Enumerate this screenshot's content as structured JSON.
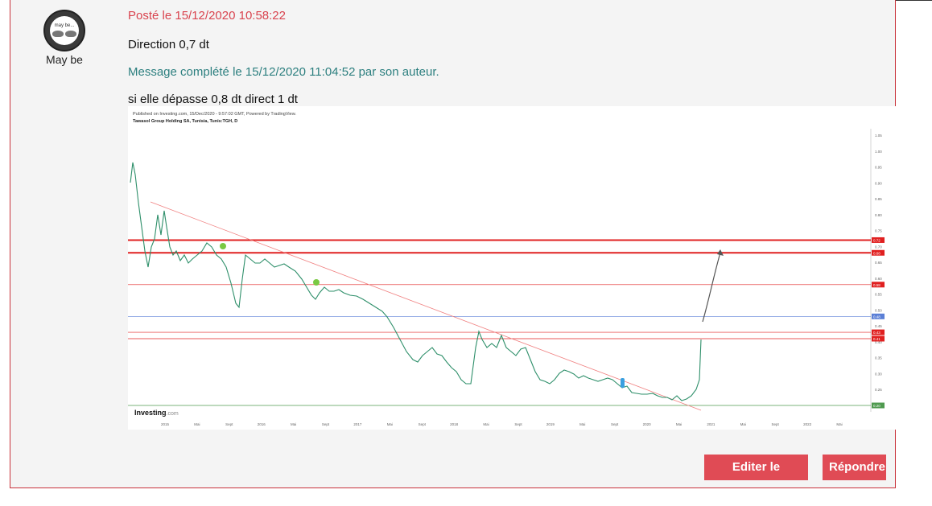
{
  "post": {
    "username": "May be",
    "avatar_text": "may be...",
    "posted_label": "Posté le 15/12/2020 10:58:22",
    "message_line1": "Direction 0,7 dt",
    "edited_note": "Message complété le 15/12/2020 11:04:52 par son auteur.",
    "message_line2": "si elle dépasse 0,8 dt direct 1 dt"
  },
  "chart_image": {
    "published": "Published on Investing.com, 15/Dec/2020 - 9:57:02 GMT, Powered by TradingView.",
    "instrument": "Tawasol Group Holding SA, Tunisia, Tunis:TGH, D",
    "watermark": "Investing",
    "watermark_suffix": ".com",
    "price_ticks": [
      "1.05",
      "1.00",
      "0.95",
      "0.90",
      "0.85",
      "0.80",
      "0.75",
      "0.70",
      "0.65",
      "0.60",
      "0.55",
      "0.50",
      "0.45",
      "0.40",
      "0.35",
      "0.30",
      "0.25",
      "0.20"
    ],
    "level_tags": [
      "0.72",
      "0.68",
      "0.58",
      "0.48",
      "0.43",
      "0.41",
      "0.20"
    ],
    "level_colors": [
      "#e02020",
      "#e02020",
      "#e02020",
      "#5b7fd6",
      "#e02020",
      "#e02020",
      "#4f9a4f"
    ],
    "time_ticks": [
      "2015",
      "Mai",
      "Sept",
      "2016",
      "Mai",
      "Sept",
      "2017",
      "Mai",
      "Sept",
      "2018",
      "Mai",
      "Sept",
      "2019",
      "Mai",
      "Sept",
      "2020",
      "Mai",
      "2021",
      "Mai",
      "Sept",
      "2022",
      "Mai"
    ]
  },
  "actions": {
    "edit_label": "Editer le message",
    "reply_label": "Répondre"
  },
  "colors": {
    "accent": "#e04b55",
    "posted": "#d9434e",
    "edited": "#2c7f7f",
    "border": "#c9323b"
  }
}
